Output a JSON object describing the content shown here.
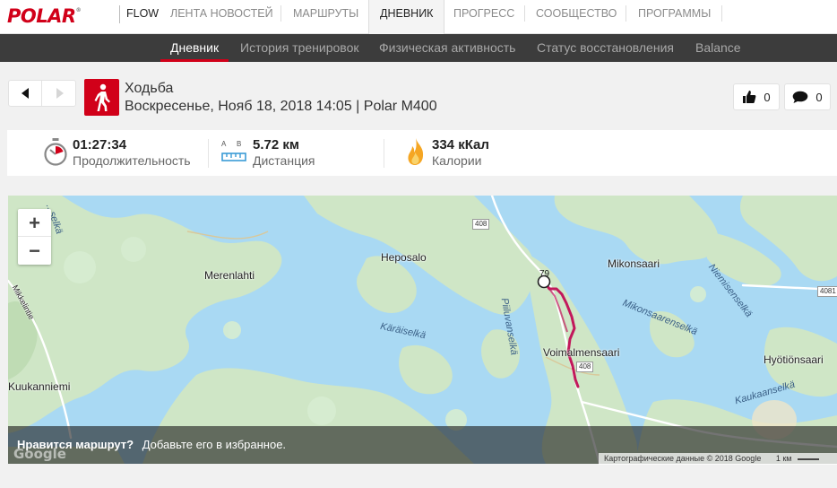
{
  "brand": {
    "logo": "POLAR",
    "product": "FLOW"
  },
  "top_nav": [
    {
      "label": "ЛЕНТА НОВОСТЕЙ",
      "active": false
    },
    {
      "label": "МАРШРУТЫ",
      "active": false
    },
    {
      "label": "ДНЕВНИК",
      "active": true
    },
    {
      "label": "ПРОГРЕСС",
      "active": false
    },
    {
      "label": "СООБЩЕСТВО",
      "active": false
    },
    {
      "label": "ПРОГРАММЫ",
      "active": false
    }
  ],
  "sub_nav": [
    {
      "label": "Дневник",
      "active": true
    },
    {
      "label": "История тренировок",
      "active": false
    },
    {
      "label": "Физическая активность",
      "active": false
    },
    {
      "label": "Статус восстановления",
      "active": false
    },
    {
      "label": "Balance",
      "active": false
    }
  ],
  "session": {
    "sport": "Ходьба",
    "meta": "Воскресенье, Нояб 18, 2018 14:05 | Polar M400",
    "sport_icon": "walking-person-icon"
  },
  "reactions": {
    "likes": "0",
    "comments": "0"
  },
  "summary": {
    "duration": {
      "value": "01:27:34",
      "label": "Продолжительность",
      "icon": "stopwatch-icon"
    },
    "distance": {
      "value": "5.72 км",
      "label": "Дистанция",
      "icon": "ruler-icon",
      "from": "A",
      "to": "B"
    },
    "calories": {
      "value": "334 кКал",
      "label": "Калории",
      "icon": "flame-icon"
    }
  },
  "map": {
    "labels": {
      "merenlahti": "Merenlahti",
      "heposalo": "Heposalo",
      "mikonsaari": "Mikonsaari",
      "niemisenselka": "Niemisenselkä",
      "mikonsaarenselka": "Mikonsaarenselkä",
      "karaiselka": "Käräiselkä",
      "piiluvanselka": "Piiluvanselkä",
      "voimalmensaari": "Voimalmensaari",
      "hyotionsaari": "Hyötiönsaari",
      "kaukaanselka": "Kaukaanselkä",
      "kuukanniemi": "Kuukanniemi",
      "mikkelintie": "Mikkelintie",
      "selka_nw": "...selkä"
    },
    "roads": {
      "r408a": "408",
      "r408b": "408",
      "r4081": "4081",
      "r79": "79"
    },
    "zoom_in": "+",
    "zoom_out": "−",
    "route_color": "#c2185b"
  },
  "banner": {
    "question": "Нравится маршрут?",
    "cta": "Добавьте его в избранное."
  },
  "attribution": {
    "text": "Картографические данные © 2018 Google",
    "scale": "1 км"
  },
  "colors": {
    "brand_red": "#d10019",
    "water": "#a9d9f3",
    "land": "#cfe6c6"
  }
}
